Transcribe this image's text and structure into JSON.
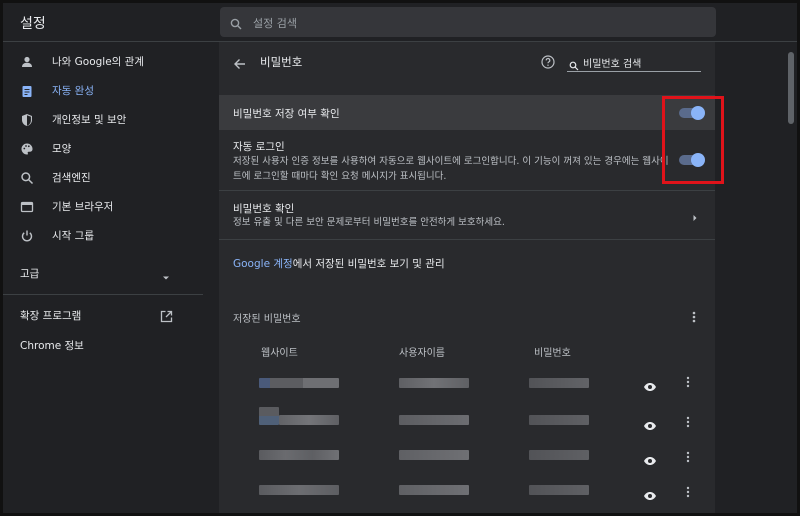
{
  "header": {
    "title": "설정",
    "search_placeholder": "설정 검색"
  },
  "sidebar": {
    "items": [
      {
        "label": "나와 Google의 관계",
        "icon": "person-icon",
        "active": false
      },
      {
        "label": "자동 완성",
        "icon": "clipboard-icon",
        "active": true
      },
      {
        "label": "개인정보 및 보안",
        "icon": "shield-icon",
        "active": false
      },
      {
        "label": "모양",
        "icon": "palette-icon",
        "active": false
      },
      {
        "label": "검색엔진",
        "icon": "search-icon",
        "active": false
      },
      {
        "label": "기본 브라우저",
        "icon": "browser-icon",
        "active": false
      },
      {
        "label": "시작 그룹",
        "icon": "power-icon",
        "active": false
      }
    ],
    "advanced": "고급",
    "extensions": "확장 프로그램",
    "about": "Chrome 정보"
  },
  "main": {
    "title": "비밀번호",
    "search_value": "비밀번호 검색",
    "offer_to_save": {
      "label": "비밀번호 저장 여부 확인",
      "enabled": true
    },
    "auto_signin": {
      "label": "자동 로그인",
      "description": "저장된 사용자 인증 정보를 사용하여 자동으로 웹사이트에 로그인합니다. 이 기능이 꺼져 있는 경우에는 웹사이트에 로그인할 때마다 확인 요청 메시지가 표시됩니다.",
      "enabled": true
    },
    "check": {
      "label": "비밀번호 확인",
      "description": "정보 유출 및 다른 보안 문제로부터 비밀번호를 안전하게 보호하세요."
    },
    "account_link": {
      "link": "Google 계정",
      "rest": "에서 저장된 비밀번호 보기 및 관리"
    },
    "saved": {
      "title": "저장된 비밀번호",
      "columns": [
        "웹사이트",
        "사용자이름",
        "비밀번호"
      ],
      "row_count": 4
    }
  },
  "colors": {
    "background": "#202124",
    "card": "#292a2d",
    "accent": "#8ab4f8",
    "highlight_box": "#e0131a"
  }
}
